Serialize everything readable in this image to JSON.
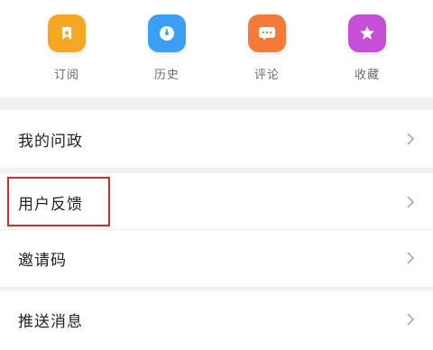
{
  "shortcuts": [
    {
      "label": "订阅",
      "icon": "bookmark-icon",
      "color": "#f5a623"
    },
    {
      "label": "历史",
      "icon": "clock-icon",
      "color": "#3b9ff3"
    },
    {
      "label": "评论",
      "icon": "chat-icon",
      "color": "#f47a38"
    },
    {
      "label": "收藏",
      "icon": "star-icon",
      "color": "#c74fd6"
    }
  ],
  "menu": {
    "questions": "我的问政",
    "feedback": "用户反馈",
    "invite_code": "邀请码",
    "push": "推送消息"
  },
  "colors": {
    "highlight": "#d52a2a",
    "background": "#f1f1f3"
  }
}
